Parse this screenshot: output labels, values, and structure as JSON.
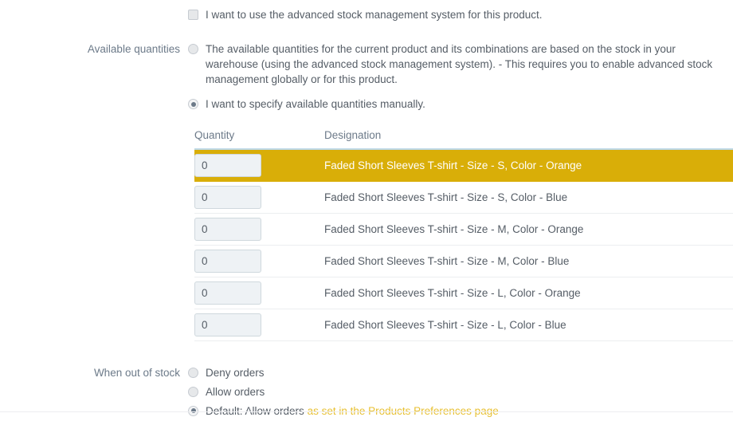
{
  "advanced_stock": {
    "label": "",
    "option_text": "I want to use the advanced stock management system for this product.",
    "checked": false
  },
  "available_quantities": {
    "label": "Available quantities",
    "option_warehouse": "The available quantities for the current product and its combinations are based on the stock in your warehouse (using the advanced stock management system).  - This requires you to enable advanced stock management globally or for this product.",
    "option_manual": "I want to specify available quantities manually."
  },
  "combinations_table": {
    "headers": {
      "quantity": "Quantity",
      "designation": "Designation"
    },
    "rows": [
      {
        "quantity": "0",
        "designation": "Faded Short Sleeves T-shirt - Size - S, Color - Orange",
        "highlighted": true
      },
      {
        "quantity": "0",
        "designation": "Faded Short Sleeves T-shirt - Size - S, Color - Blue",
        "highlighted": false
      },
      {
        "quantity": "0",
        "designation": "Faded Short Sleeves T-shirt - Size - M, Color - Orange",
        "highlighted": false
      },
      {
        "quantity": "0",
        "designation": "Faded Short Sleeves T-shirt - Size - M, Color - Blue",
        "highlighted": false
      },
      {
        "quantity": "0",
        "designation": "Faded Short Sleeves T-shirt - Size - L, Color - Orange",
        "highlighted": false
      },
      {
        "quantity": "0",
        "designation": "Faded Short Sleeves T-shirt - Size - L, Color - Blue",
        "highlighted": false
      }
    ]
  },
  "out_of_stock": {
    "label": "When out of stock",
    "option_deny": "Deny orders",
    "option_allow": "Allow orders",
    "option_default_prefix": "Default: Allow orders",
    "option_default_link": "as set in the Products Preferences page"
  },
  "colors": {
    "highlight_row": "#d9ae08",
    "link_gold": "#e8c133",
    "header_rule": "#bdd8e6",
    "label_text": "#6c7a89",
    "body_text": "#555d66"
  }
}
